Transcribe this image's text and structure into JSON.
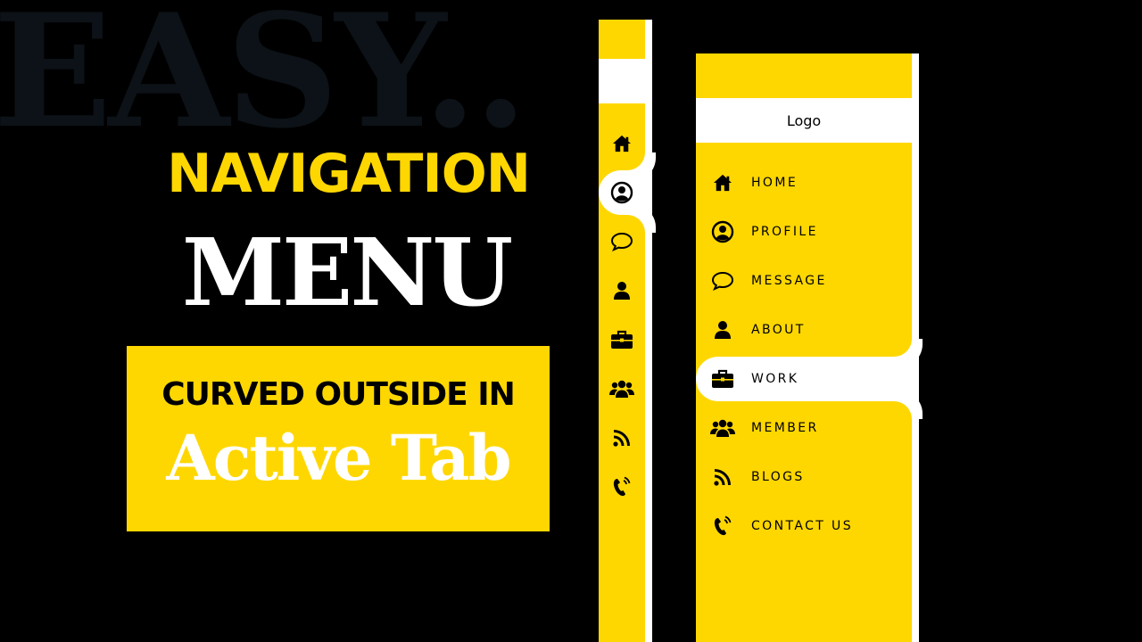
{
  "thumbnail": {
    "background_word": "EASY..",
    "headline_line1": "NAVIGATION",
    "headline_line2": "MENU",
    "badge_line1": "CURVED OUTSIDE IN",
    "badge_line2": "Active Tab"
  },
  "colors": {
    "accent": "#ffd700",
    "background": "#000000",
    "surface": "#ffffff",
    "text": "#000000"
  },
  "compact_sidebar": {
    "active_index": 1,
    "items": [
      {
        "icon": "home-icon"
      },
      {
        "icon": "user-circle-icon"
      },
      {
        "icon": "message-icon"
      },
      {
        "icon": "user-icon"
      },
      {
        "icon": "briefcase-icon"
      },
      {
        "icon": "users-icon"
      },
      {
        "icon": "rss-icon"
      },
      {
        "icon": "phone-icon"
      }
    ]
  },
  "sidebar": {
    "logo": "Logo",
    "active_index": 4,
    "items": [
      {
        "label": "HOME",
        "icon": "home-icon"
      },
      {
        "label": "PROFILE",
        "icon": "user-circle-icon"
      },
      {
        "label": "MESSAGE",
        "icon": "message-icon"
      },
      {
        "label": "ABOUT",
        "icon": "user-icon"
      },
      {
        "label": "WORK",
        "icon": "briefcase-icon"
      },
      {
        "label": "MEMBER",
        "icon": "users-icon"
      },
      {
        "label": "BLOGS",
        "icon": "rss-icon"
      },
      {
        "label": "CONTACT US",
        "icon": "phone-icon"
      }
    ]
  }
}
